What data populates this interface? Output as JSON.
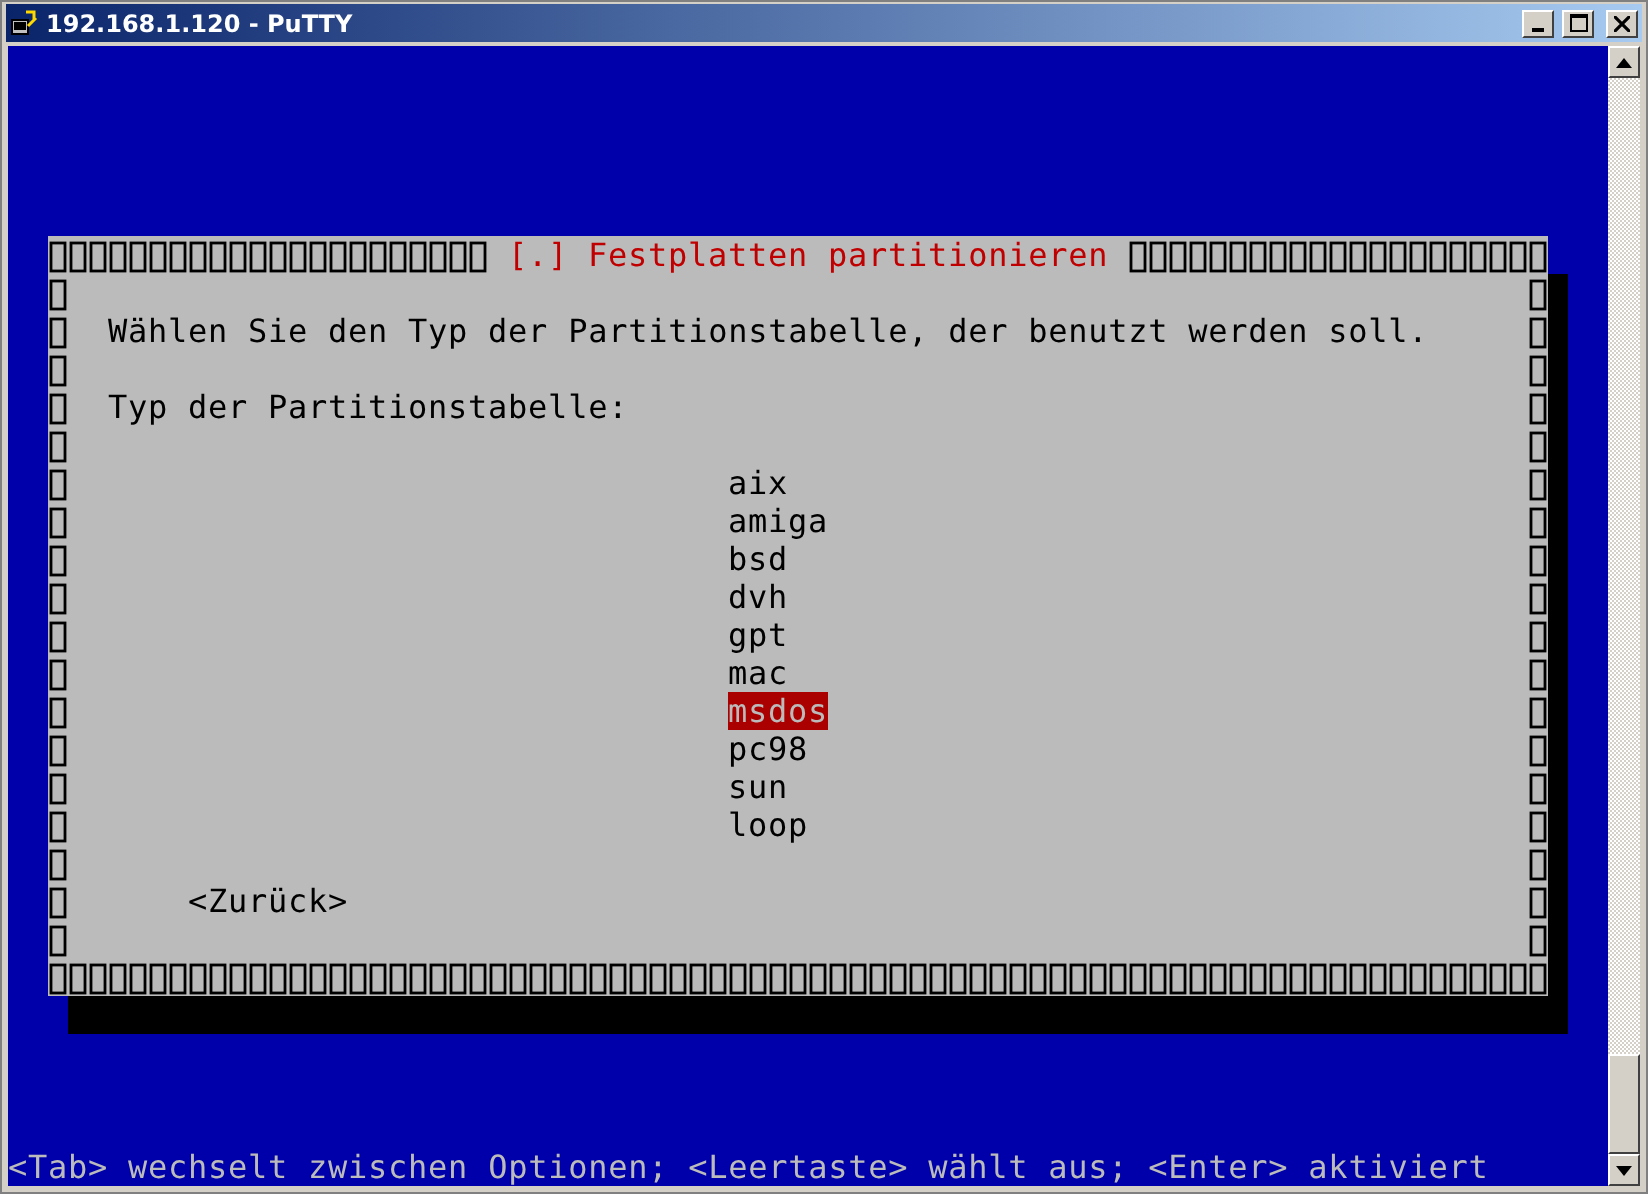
{
  "window": {
    "title": "192.168.1.120 - PuTTY"
  },
  "dialog": {
    "title": "[.] Festplatten partitionieren",
    "prompt": "Wählen Sie den Typ der Partitionstabelle, der benutzt werden soll.",
    "label": "Typ der Partitionstabelle:",
    "options": [
      {
        "label": "aix",
        "selected": false
      },
      {
        "label": "amiga",
        "selected": false
      },
      {
        "label": "bsd",
        "selected": false
      },
      {
        "label": "dvh",
        "selected": false
      },
      {
        "label": "gpt",
        "selected": false
      },
      {
        "label": "mac",
        "selected": false
      },
      {
        "label": "msdos",
        "selected": true
      },
      {
        "label": "pc98",
        "selected": false
      },
      {
        "label": "sun",
        "selected": false
      },
      {
        "label": "loop",
        "selected": false
      }
    ],
    "back_button": "<Zurück>"
  },
  "status_line": "<Tab> wechselt zwischen Optionen; <Leertaste> wählt aus; <Enter> aktiviert"
}
